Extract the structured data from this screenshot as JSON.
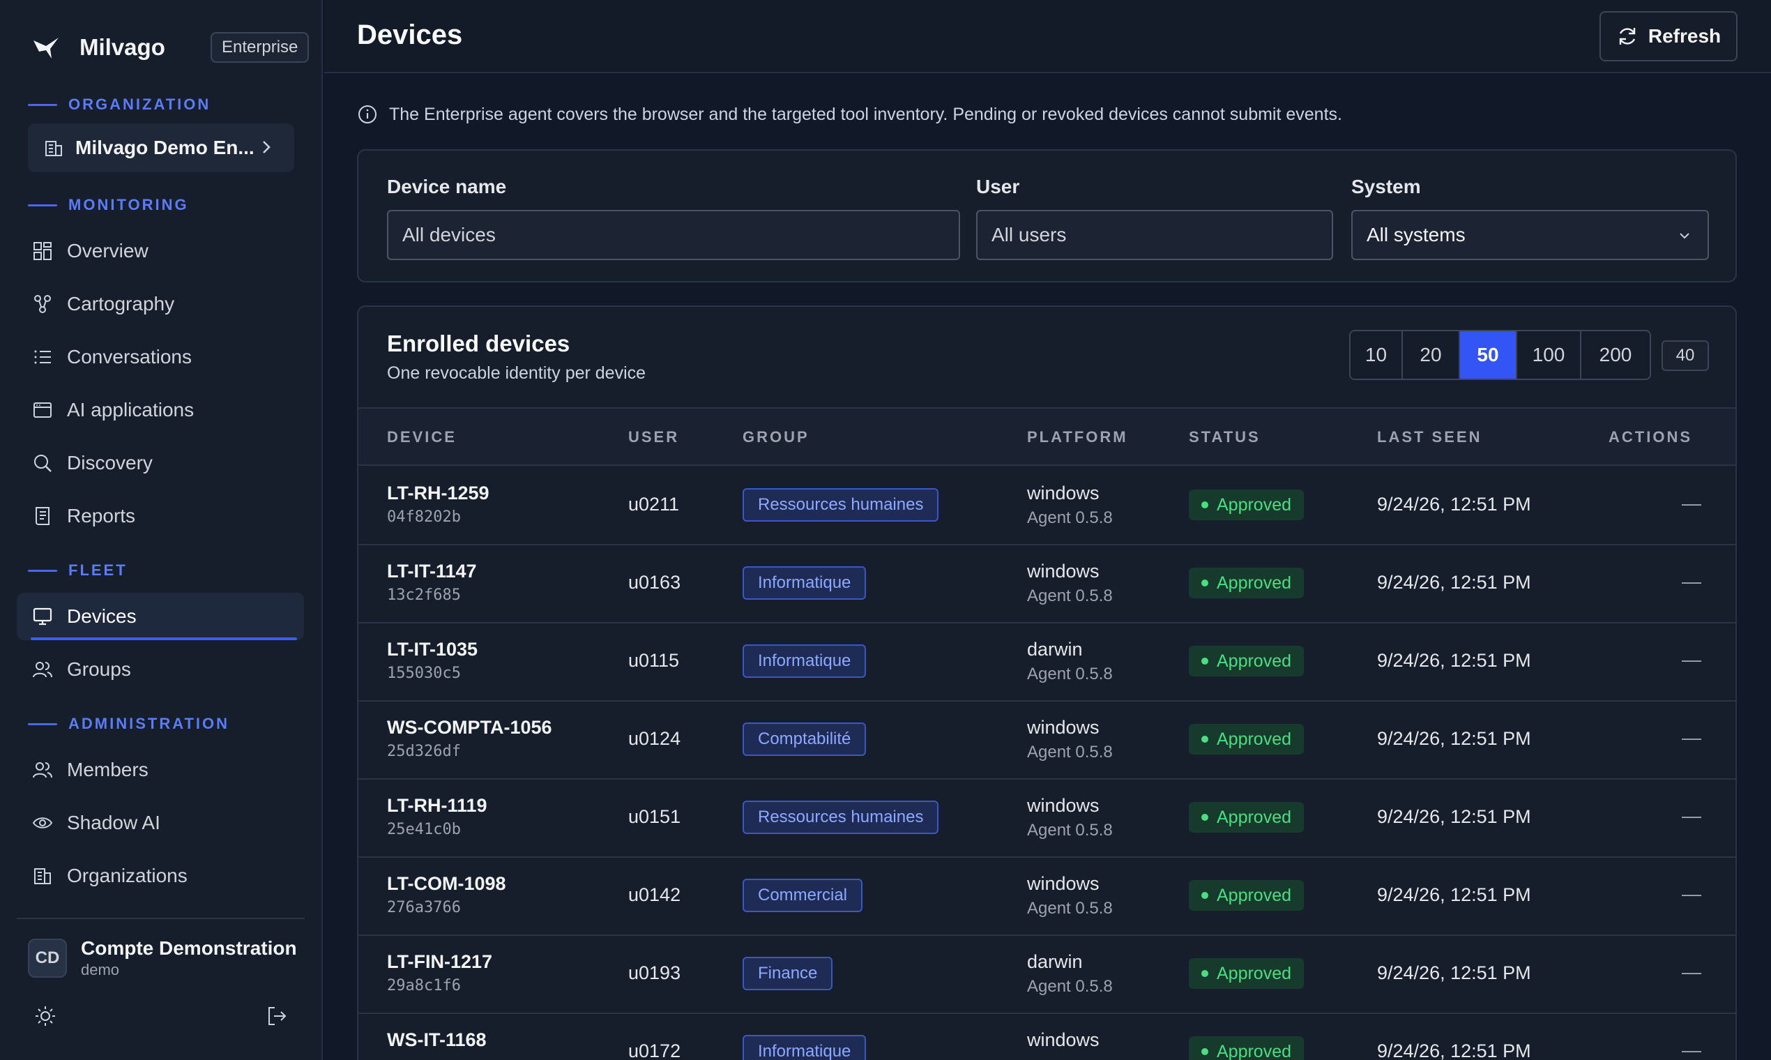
{
  "app": {
    "name": "Milvago",
    "edition": "Enterprise"
  },
  "sidebar": {
    "sections": {
      "organization": "ORGANIZATION",
      "monitoring": "MONITORING",
      "fleet": "FLEET",
      "administration": "ADMINISTRATION"
    },
    "org_selector": "Milvago Demo En...",
    "items": {
      "overview": "Overview",
      "cartography": "Cartography",
      "conversations": "Conversations",
      "ai_applications": "AI applications",
      "discovery": "Discovery",
      "reports": "Reports",
      "devices": "Devices",
      "groups": "Groups",
      "members": "Members",
      "shadow_ai": "Shadow AI",
      "organizations": "Organizations"
    },
    "active_item": "devices",
    "user": {
      "initials": "CD",
      "name": "Compte Demonstration",
      "login": "demo"
    }
  },
  "header": {
    "title": "Devices",
    "refresh_label": "Refresh"
  },
  "info_text": "The Enterprise agent covers the browser and the targeted tool inventory. Pending or revoked devices cannot submit events.",
  "filters": {
    "device_label": "Device name",
    "device_placeholder": "All devices",
    "user_label": "User",
    "user_placeholder": "All users",
    "system_label": "System",
    "system_value": "All systems"
  },
  "table": {
    "title": "Enrolled devices",
    "subtitle": "One revocable identity per device",
    "page_sizes": [
      "10",
      "20",
      "50",
      "100",
      "200"
    ],
    "selected_page_size": "50",
    "count": "40",
    "columns": {
      "device": "DEVICE",
      "user": "USER",
      "group": "GROUP",
      "platform": "PLATFORM",
      "status": "STATUS",
      "last_seen": "LAST SEEN",
      "actions": "ACTIONS"
    },
    "rows": [
      {
        "name": "LT-RH-1259",
        "id": "04f8202b",
        "user": "u0211",
        "group": "Ressources humaines",
        "platform": "windows",
        "agent": "Agent 0.5.8",
        "status": "Approved",
        "last_seen": "9/24/26, 12:51 PM",
        "action": "—"
      },
      {
        "name": "LT-IT-1147",
        "id": "13c2f685",
        "user": "u0163",
        "group": "Informatique",
        "platform": "windows",
        "agent": "Agent 0.5.8",
        "status": "Approved",
        "last_seen": "9/24/26, 12:51 PM",
        "action": "—"
      },
      {
        "name": "LT-IT-1035",
        "id": "155030c5",
        "user": "u0115",
        "group": "Informatique",
        "platform": "darwin",
        "agent": "Agent 0.5.8",
        "status": "Approved",
        "last_seen": "9/24/26, 12:51 PM",
        "action": "—"
      },
      {
        "name": "WS-COMPTA-1056",
        "id": "25d326df",
        "user": "u0124",
        "group": "Comptabilité",
        "platform": "windows",
        "agent": "Agent 0.5.8",
        "status": "Approved",
        "last_seen": "9/24/26, 12:51 PM",
        "action": "—"
      },
      {
        "name": "LT-RH-1119",
        "id": "25e41c0b",
        "user": "u0151",
        "group": "Ressources humaines",
        "platform": "windows",
        "agent": "Agent 0.5.8",
        "status": "Approved",
        "last_seen": "9/24/26, 12:51 PM",
        "action": "—"
      },
      {
        "name": "LT-COM-1098",
        "id": "276a3766",
        "user": "u0142",
        "group": "Commercial",
        "platform": "windows",
        "agent": "Agent 0.5.8",
        "status": "Approved",
        "last_seen": "9/24/26, 12:51 PM",
        "action": "—"
      },
      {
        "name": "LT-FIN-1217",
        "id": "29a8c1f6",
        "user": "u0193",
        "group": "Finance",
        "platform": "darwin",
        "agent": "Agent 0.5.8",
        "status": "Approved",
        "last_seen": "9/24/26, 12:51 PM",
        "action": "—"
      },
      {
        "name": "WS-IT-1168",
        "id": "",
        "user": "u0172",
        "group": "Informatique",
        "platform": "windows",
        "agent": "",
        "status": "Approved",
        "last_seen": "9/24/26, 12:51 PM",
        "action": "—"
      }
    ]
  },
  "colors": {
    "accent": "#3355f5",
    "approved": "#4ade80",
    "group_tag": "#8fa8ff"
  }
}
